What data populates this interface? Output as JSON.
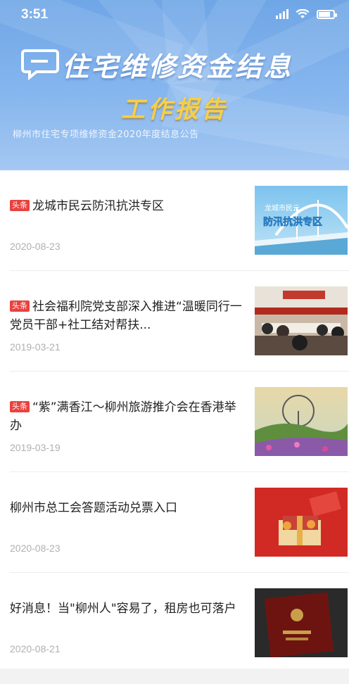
{
  "status_bar": {
    "time": "3:51"
  },
  "banner": {
    "title": "住宅维修资金结息",
    "subtitle": "工作报告",
    "caption": "柳州市住宅专项维修资金2020年度结息公告"
  },
  "news": [
    {
      "badge": "头条",
      "title": "龙城市民云防汛抗洪专区",
      "date": "2020-08-23",
      "thumb_text": "防汛抗洪专区",
      "thumb_small": "龙城市民云"
    },
    {
      "badge": "头条",
      "title": "社会福利院党支部深入推进“温暖同行一 党员干部+社工结对帮扶...",
      "date": "2019-03-21"
    },
    {
      "badge": "头条",
      "title": "“紫”满香江～柳州旅游推介会在香港举办",
      "date": "2019-03-19"
    },
    {
      "badge": "",
      "title": "柳州市总工会答题活动兑票入口",
      "date": "2020-08-23"
    },
    {
      "badge": "",
      "title": "好消息！当\"柳州人\"容易了，租房也可落户",
      "date": "2020-08-21"
    }
  ]
}
